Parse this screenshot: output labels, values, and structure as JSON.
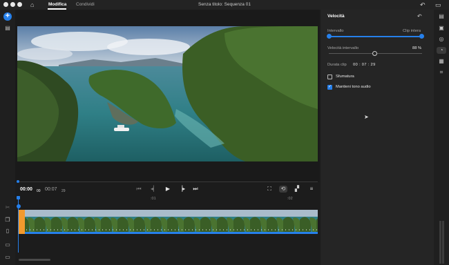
{
  "titlebar": {
    "tabs": [
      {
        "label": "Modifica",
        "active": true
      },
      {
        "label": "Condividi",
        "active": false
      }
    ],
    "document_title": "Senza titolo: Sequenza 01",
    "icons": [
      "home-icon",
      "undo-icon",
      "feedback-icon"
    ]
  },
  "left_rail": {
    "icons": [
      "add-icon",
      "media-icon",
      "scissors-icon",
      "copy-icon",
      "trash-icon",
      "track-icon",
      "fit-icon"
    ]
  },
  "player": {
    "current_time": "00:00",
    "current_frames": "00",
    "duration": "00:07",
    "duration_frames": "29",
    "transport": [
      "go-to-start-icon",
      "step-back-icon",
      "play-icon",
      "step-forward-icon",
      "go-to-end-icon"
    ],
    "controls": [
      "fit-screen-icon",
      "loop-icon",
      "safe-zones-icon",
      "menu-icon"
    ]
  },
  "timeline": {
    "ruler": [
      ":01",
      ":02"
    ]
  },
  "panel": {
    "title": "Velocità",
    "range_label": "Intervallo",
    "range_end_label": "Clip intera",
    "speed_label": "Velocità intervallo",
    "speed_value": "88 %",
    "speed_fraction": 0.49,
    "duration_label": "Durata clip",
    "duration_value": "00 : 07 : 29",
    "options": [
      {
        "label": "Sfumatura",
        "checked": false
      },
      {
        "label": "Mantieni tono audio",
        "checked": true
      }
    ]
  },
  "right_rail": {
    "icons": [
      "properties-icon",
      "media-icon",
      "color-icon",
      "speed-icon",
      "layout-icon",
      "crop-icon"
    ]
  },
  "colors": {
    "accent": "#2680eb",
    "clip_handle": "#f29a2e",
    "background": "#1c1c1c",
    "panel": "#252525"
  }
}
